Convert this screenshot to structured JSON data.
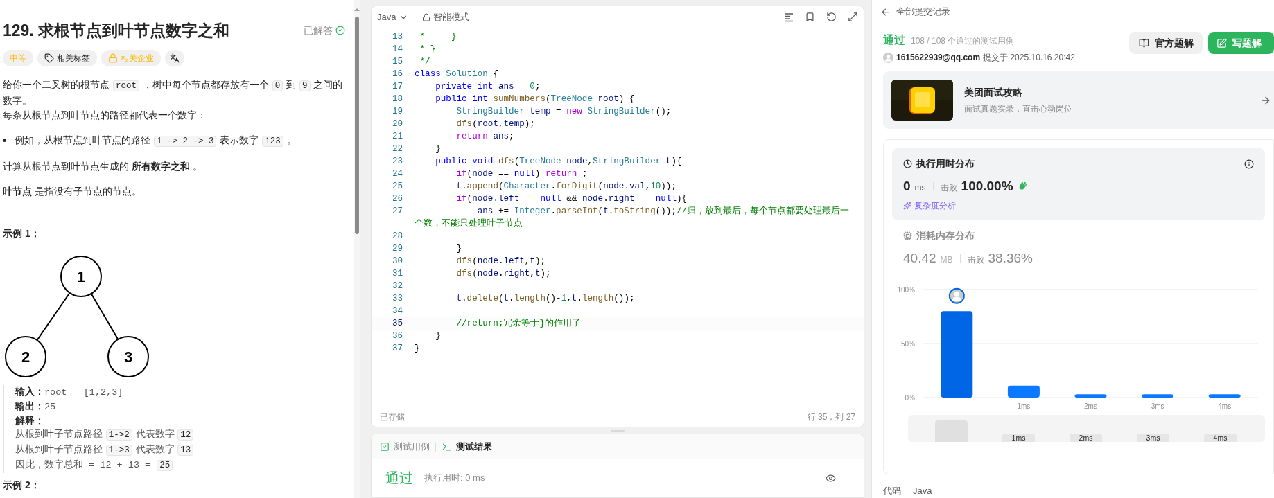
{
  "problem": {
    "title": "129. 求根节点到叶节点数字之和",
    "status": "已解答",
    "solved": true,
    "tags": [
      {
        "label": "中等",
        "kind": "difficulty"
      },
      {
        "label": "相关标签",
        "kind": "tag"
      },
      {
        "label": "相关企业",
        "kind": "locked"
      },
      {
        "kind": "translate"
      }
    ],
    "paragraphs": [
      {
        "kind": "text",
        "segments": [
          {
            "kind": "text",
            "text": "给你一个二叉树的根节点 "
          },
          {
            "kind": "code",
            "text": "root"
          },
          {
            "kind": "text",
            "text": " ，树中每个节点都存放有一个 "
          },
          {
            "kind": "code",
            "text": "0"
          },
          {
            "kind": "text",
            "text": " 到 "
          },
          {
            "kind": "code",
            "text": "9"
          },
          {
            "kind": "text",
            "text": " 之间的数字。"
          }
        ]
      },
      {
        "kind": "text",
        "segments": [
          {
            "kind": "text",
            "text": "每条从根节点到叶节点的路径都代表一个数字："
          }
        ]
      },
      {
        "kind": "bullet",
        "segments": [
          {
            "kind": "text",
            "text": "例如，从根节点到叶节点的路径 "
          },
          {
            "kind": "code",
            "text": "1 -> 2 -> 3"
          },
          {
            "kind": "text",
            "text": " 表示数字 "
          },
          {
            "kind": "code",
            "text": "123"
          },
          {
            "kind": "text",
            "text": " 。"
          }
        ]
      },
      {
        "kind": "text",
        "segments": [
          {
            "kind": "text",
            "text": "计算从根节点到叶节点生成的 "
          },
          {
            "kind": "bold",
            "text": "所有数字之和"
          },
          {
            "kind": "text",
            "text": " 。"
          }
        ]
      },
      {
        "kind": "text",
        "segments": [
          {
            "kind": "bold",
            "text": "叶节点"
          },
          {
            "kind": "text",
            "text": " 是指没有子节点的节点。"
          }
        ]
      }
    ],
    "example_title": "示例 1：",
    "tree": {
      "value": "1",
      "children": [
        {
          "value": "2"
        },
        {
          "value": "3"
        }
      ]
    },
    "example_lines": [
      [
        {
          "kind": "bold",
          "text": "输入："
        },
        {
          "kind": "mono",
          "text": "root = [1,2,3]"
        }
      ],
      [
        {
          "kind": "bold",
          "text": "输出："
        },
        {
          "kind": "mono",
          "text": "25"
        }
      ],
      [
        {
          "kind": "bold",
          "text": "解释："
        }
      ],
      [
        {
          "kind": "text",
          "text": "从根到叶子节点路径 "
        },
        {
          "kind": "code",
          "text": "1->2"
        },
        {
          "kind": "text",
          "text": " 代表数字 "
        },
        {
          "kind": "code",
          "text": "12"
        }
      ],
      [
        {
          "kind": "text",
          "text": "从根到叶子节点路径 "
        },
        {
          "kind": "code",
          "text": "1->3"
        },
        {
          "kind": "text",
          "text": " 代表数字 "
        },
        {
          "kind": "code",
          "text": "13"
        }
      ],
      [
        {
          "kind": "mono",
          "text": "因此，数字总和 = 12 + 13 = "
        },
        {
          "kind": "code",
          "text": "25"
        }
      ]
    ],
    "next_example_title": "示例 2："
  },
  "editor": {
    "language": "Java",
    "mode": "智能模式",
    "saved": "已存储",
    "cursor": "行 35，列 27",
    "lines": [
      {
        "no": "13",
        "current": false,
        "tokens": [
          {
            "kind": "comment",
            "text": " *     }"
          }
        ]
      },
      {
        "no": "14",
        "current": false,
        "tokens": [
          {
            "kind": "comment",
            "text": " * }"
          }
        ]
      },
      {
        "no": "15",
        "current": false,
        "tokens": [
          {
            "kind": "comment",
            "text": " */"
          }
        ]
      },
      {
        "no": "16",
        "current": false,
        "tokens": [
          {
            "kind": "keyword",
            "text": "class "
          },
          {
            "kind": "type",
            "text": "Solution"
          },
          {
            "kind": "plain",
            "text": " {"
          }
        ]
      },
      {
        "no": "17",
        "current": false,
        "tokens": [
          {
            "kind": "keyword",
            "text": "    private int "
          },
          {
            "kind": "variable",
            "text": "ans"
          },
          {
            "kind": "plain",
            "text": " = "
          },
          {
            "kind": "number",
            "text": "0"
          },
          {
            "kind": "plain",
            "text": ";"
          }
        ]
      },
      {
        "no": "18",
        "current": false,
        "tokens": [
          {
            "kind": "keyword",
            "text": "    public int "
          },
          {
            "kind": "function",
            "text": "sumNumbers"
          },
          {
            "kind": "plain",
            "text": "("
          },
          {
            "kind": "type",
            "text": "TreeNode"
          },
          {
            "kind": "variable",
            "text": " root"
          },
          {
            "kind": "plain",
            "text": ") {"
          }
        ]
      },
      {
        "no": "19",
        "current": false,
        "tokens": [
          {
            "kind": "type",
            "text": "        StringBuilder"
          },
          {
            "kind": "variable",
            "text": " temp"
          },
          {
            "kind": "plain",
            "text": " = "
          },
          {
            "kind": "control",
            "text": "new "
          },
          {
            "kind": "type",
            "text": "StringBuilder"
          },
          {
            "kind": "plain",
            "text": "();"
          }
        ]
      },
      {
        "no": "20",
        "current": false,
        "tokens": [
          {
            "kind": "function",
            "text": "        dfs"
          },
          {
            "kind": "plain",
            "text": "("
          },
          {
            "kind": "variable",
            "text": "root"
          },
          {
            "kind": "plain",
            "text": ","
          },
          {
            "kind": "variable",
            "text": "temp"
          },
          {
            "kind": "plain",
            "text": ");"
          }
        ]
      },
      {
        "no": "21",
        "current": false,
        "tokens": [
          {
            "kind": "control",
            "text": "        return "
          },
          {
            "kind": "variable",
            "text": "ans"
          },
          {
            "kind": "plain",
            "text": ";"
          }
        ]
      },
      {
        "no": "22",
        "current": false,
        "tokens": [
          {
            "kind": "plain",
            "text": "    }"
          }
        ]
      },
      {
        "no": "23",
        "current": false,
        "tokens": [
          {
            "kind": "keyword",
            "text": "    public void "
          },
          {
            "kind": "function",
            "text": "dfs"
          },
          {
            "kind": "plain",
            "text": "("
          },
          {
            "kind": "type",
            "text": "TreeNode"
          },
          {
            "kind": "variable",
            "text": " node"
          },
          {
            "kind": "plain",
            "text": ","
          },
          {
            "kind": "type",
            "text": "StringBuilder"
          },
          {
            "kind": "variable",
            "text": " t"
          },
          {
            "kind": "plain",
            "text": "){"
          }
        ]
      },
      {
        "no": "24",
        "current": false,
        "tokens": [
          {
            "kind": "control",
            "text": "        if"
          },
          {
            "kind": "plain",
            "text": "("
          },
          {
            "kind": "variable",
            "text": "node"
          },
          {
            "kind": "plain",
            "text": " == "
          },
          {
            "kind": "keyword",
            "text": "null"
          },
          {
            "kind": "plain",
            "text": ") "
          },
          {
            "kind": "control",
            "text": "return"
          },
          {
            "kind": "plain",
            "text": " ;"
          }
        ]
      },
      {
        "no": "25",
        "current": false,
        "tokens": [
          {
            "kind": "variable",
            "text": "        t"
          },
          {
            "kind": "plain",
            "text": "."
          },
          {
            "kind": "function",
            "text": "append"
          },
          {
            "kind": "plain",
            "text": "("
          },
          {
            "kind": "type",
            "text": "Character"
          },
          {
            "kind": "plain",
            "text": "."
          },
          {
            "kind": "function",
            "text": "forDigit"
          },
          {
            "kind": "plain",
            "text": "("
          },
          {
            "kind": "variable",
            "text": "node"
          },
          {
            "kind": "plain",
            "text": "."
          },
          {
            "kind": "variable",
            "text": "val"
          },
          {
            "kind": "plain",
            "text": ","
          },
          {
            "kind": "number",
            "text": "10"
          },
          {
            "kind": "plain",
            "text": "));"
          }
        ]
      },
      {
        "no": "26",
        "current": false,
        "tokens": [
          {
            "kind": "control",
            "text": "        if"
          },
          {
            "kind": "plain",
            "text": "("
          },
          {
            "kind": "variable",
            "text": "node"
          },
          {
            "kind": "plain",
            "text": "."
          },
          {
            "kind": "variable",
            "text": "left"
          },
          {
            "kind": "plain",
            "text": " == "
          },
          {
            "kind": "keyword",
            "text": "null"
          },
          {
            "kind": "plain",
            "text": " && "
          },
          {
            "kind": "variable",
            "text": "node"
          },
          {
            "kind": "plain",
            "text": "."
          },
          {
            "kind": "variable",
            "text": "right"
          },
          {
            "kind": "plain",
            "text": " == "
          },
          {
            "kind": "keyword",
            "text": "null"
          },
          {
            "kind": "plain",
            "text": "){"
          }
        ]
      },
      {
        "no": "27",
        "current": false,
        "tokens": [
          {
            "kind": "variable",
            "text": "            ans"
          },
          {
            "kind": "plain",
            "text": " += "
          },
          {
            "kind": "type",
            "text": "Integer"
          },
          {
            "kind": "plain",
            "text": "."
          },
          {
            "kind": "function",
            "text": "parseInt"
          },
          {
            "kind": "plain",
            "text": "("
          },
          {
            "kind": "variable",
            "text": "t"
          },
          {
            "kind": "plain",
            "text": "."
          },
          {
            "kind": "function",
            "text": "toString"
          },
          {
            "kind": "plain",
            "text": "());"
          },
          {
            "kind": "comment",
            "text": "//归，放到最后，每个节点都要处理最后一个数，不能只处理叶子节点"
          }
        ]
      },
      {
        "no": "28",
        "current": false
      },
      {
        "no": "29",
        "current": false,
        "tokens": [
          {
            "kind": "plain",
            "text": "        }"
          }
        ]
      },
      {
        "no": "30",
        "current": false,
        "tokens": [
          {
            "kind": "function",
            "text": "        dfs"
          },
          {
            "kind": "plain",
            "text": "("
          },
          {
            "kind": "variable",
            "text": "node"
          },
          {
            "kind": "plain",
            "text": "."
          },
          {
            "kind": "variable",
            "text": "left"
          },
          {
            "kind": "plain",
            "text": ","
          },
          {
            "kind": "variable",
            "text": "t"
          },
          {
            "kind": "plain",
            "text": ");"
          }
        ]
      },
      {
        "no": "31",
        "current": false,
        "tokens": [
          {
            "kind": "function",
            "text": "        dfs"
          },
          {
            "kind": "plain",
            "text": "("
          },
          {
            "kind": "variable",
            "text": "node"
          },
          {
            "kind": "plain",
            "text": "."
          },
          {
            "kind": "variable",
            "text": "right"
          },
          {
            "kind": "plain",
            "text": ","
          },
          {
            "kind": "variable",
            "text": "t"
          },
          {
            "kind": "plain",
            "text": ");"
          }
        ]
      },
      {
        "no": "32",
        "current": false
      },
      {
        "no": "33",
        "current": false,
        "tokens": [
          {
            "kind": "variable",
            "text": "        t"
          },
          {
            "kind": "plain",
            "text": "."
          },
          {
            "kind": "function",
            "text": "delete"
          },
          {
            "kind": "plain",
            "text": "("
          },
          {
            "kind": "variable",
            "text": "t"
          },
          {
            "kind": "plain",
            "text": "."
          },
          {
            "kind": "function",
            "text": "length"
          },
          {
            "kind": "plain",
            "text": "()-"
          },
          {
            "kind": "number",
            "text": "1"
          },
          {
            "kind": "plain",
            "text": ","
          },
          {
            "kind": "variable",
            "text": "t"
          },
          {
            "kind": "plain",
            "text": "."
          },
          {
            "kind": "function",
            "text": "length"
          },
          {
            "kind": "plain",
            "text": "());"
          }
        ]
      },
      {
        "no": "34",
        "current": false
      },
      {
        "no": "35",
        "current": true,
        "tokens": [
          {
            "kind": "comment",
            "text": "        //return;冗余等于}的作用了"
          }
        ]
      },
      {
        "no": "36",
        "current": false,
        "tokens": [
          {
            "kind": "plain",
            "text": "    }"
          }
        ]
      },
      {
        "no": "37",
        "current": false,
        "tokens": [
          {
            "kind": "plain",
            "text": "}"
          }
        ]
      }
    ]
  },
  "console": {
    "tabs": [
      {
        "label": "测试用例",
        "kind": "cases",
        "selected": false
      },
      {
        "label": "测试结果",
        "kind": "result",
        "selected": true
      }
    ],
    "result": "通过",
    "runtime": "执行用时: 0 ms"
  },
  "submission": {
    "back_label": "全部提交记录",
    "status": "通过",
    "cases": "108 / 108 个通过的测试用例",
    "user": "1615622939@qq.com",
    "submitted": "提交于 2025.10.16 20:42",
    "buttons": [
      {
        "label": "官方题解",
        "kind": "secondary"
      },
      {
        "label": "写题解",
        "kind": "primary"
      }
    ],
    "promo": {
      "title": "美团面试攻略",
      "subtitle": "面试真题实录，直击心动岗位"
    },
    "metrics": [
      {
        "kind": "runtime",
        "title": "执行用时分布",
        "selected": true,
        "value": "0",
        "unit": "ms",
        "beat_label": "击败",
        "beat": "100.00%",
        "analysis": "复杂度分析"
      },
      {
        "kind": "memory",
        "title": "消耗内存分布",
        "selected": false,
        "value": "40.42",
        "unit": "MB",
        "beat_label": "击败",
        "beat": "38.36%"
      }
    ],
    "chart_data": {
      "type": "bar",
      "categories": [
        null,
        "1ms",
        "2ms",
        "3ms",
        "4ms"
      ],
      "series": [
        {
          "values": [
            0.8,
            0.11,
            0.03,
            0.03,
            0.03
          ]
        }
      ],
      "ylim": [
        0,
        1
      ],
      "yticks": [
        {
          "value": 0,
          "label": "0%"
        },
        {
          "value": 0.5,
          "label": "50%"
        },
        {
          "value": 1,
          "label": "100%"
        }
      ]
    },
    "bin_markers": [
      {
        "selected": true
      },
      {
        "selected": false
      },
      {
        "selected": false
      },
      {
        "selected": false
      },
      {
        "selected": false
      }
    ],
    "navigator": {
      "labels": [
        "1ms",
        "2ms",
        "3ms",
        "4ms"
      ]
    },
    "code_label": "代码",
    "code_language": "Java"
  }
}
